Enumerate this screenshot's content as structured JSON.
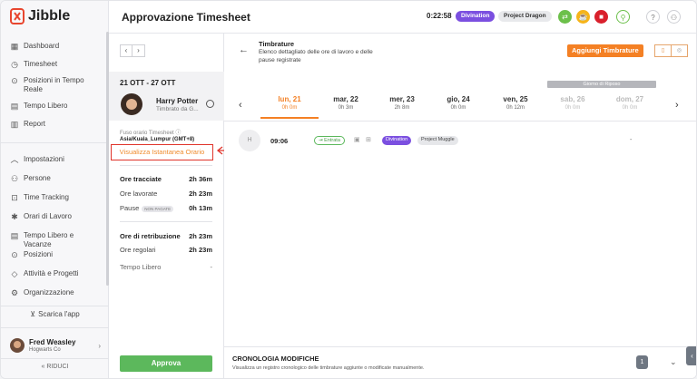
{
  "app": {
    "brand": "Jibble",
    "page_title": "Approvazione Timesheet"
  },
  "sidebar": {
    "items_top": [
      {
        "label": "Dashboard",
        "icon": "dashboard-icon"
      },
      {
        "label": "Timesheet",
        "icon": "clock-icon"
      },
      {
        "label": "Posizioni in Tempo Reale",
        "icon": "location-icon"
      },
      {
        "label": "Tempo Libero",
        "icon": "calendar-icon"
      },
      {
        "label": "Report",
        "icon": "report-icon"
      }
    ],
    "items_bottom": [
      {
        "label": "Impostazioni",
        "icon": "chevron-up-icon"
      },
      {
        "label": "Persone",
        "icon": "people-icon"
      },
      {
        "label": "Time Tracking",
        "icon": "time-tracking-icon"
      },
      {
        "label": "Orari di Lavoro",
        "icon": "work-schedule-icon"
      },
      {
        "label": "Tempo Libero e Vacanze",
        "icon": "calendar-icon"
      },
      {
        "label": "Posizioni",
        "icon": "location-icon"
      },
      {
        "label": "Attività e Progetti",
        "icon": "tag-icon"
      },
      {
        "label": "Organizzazione",
        "icon": "gear-icon"
      }
    ],
    "download": "Scarica l'app",
    "user": {
      "name": "Fred Weasley",
      "org": "Hogwarts Co"
    },
    "collapse": "RIDUCI"
  },
  "topbar": {
    "timer": "0:22:58",
    "activity": "Divination",
    "project": "Project Dragon"
  },
  "panel": {
    "week": "21 OTT - 27 OTT",
    "person": {
      "name": "Harry Potter",
      "status": "Timbrato da G..."
    },
    "tz_label": "Fuso orario Timesheet",
    "tz_value": "Asia/Kuala_Lumpur (GMT+8)",
    "snapshot_link": "Visualizza Istantanea Orario",
    "tracked": {
      "label": "Ore tracciate",
      "value": "2h 36m"
    },
    "worked": {
      "label": "Ore lavorate",
      "value": "2h 23m"
    },
    "breaks": {
      "label": "Pause",
      "badge": "NON PAGATE",
      "value": "0h 13m"
    },
    "pay": {
      "label": "Ore di retribuzione",
      "value": "2h 23m"
    },
    "regular": {
      "label": "Ore regolari",
      "value": "2h 23m"
    },
    "free": {
      "label": "Tempo Libero",
      "value": "-"
    },
    "approve": "Approva"
  },
  "main": {
    "section_title": "Timbrature",
    "section_desc": "Elenco dettagliato delle ore di lavoro e delle pause registrate",
    "add_button": "Aggiungi Timbrature",
    "rest_day": "Giorno di Riposo",
    "days": [
      {
        "name": "lun, 21",
        "hours": "0h 0m"
      },
      {
        "name": "mar, 22",
        "hours": "0h 3m"
      },
      {
        "name": "mer, 23",
        "hours": "2h 8m"
      },
      {
        "name": "gio, 24",
        "hours": "0h 0m"
      },
      {
        "name": "ven, 25",
        "hours": "0h 12m"
      },
      {
        "name": "sab, 26",
        "hours": "0h 0m"
      },
      {
        "name": "dom, 27",
        "hours": "0h 0m"
      }
    ],
    "entry": {
      "avatar": "H",
      "time": "09:06",
      "type": "Entrata",
      "activity": "Divination",
      "project": "Project Muggle",
      "dash": "-"
    },
    "history": {
      "title": "CRONOLOGIA MODIFICHE",
      "desc": "Visualizza un registro cronologico delle timbrature aggiunte o modificate manualmente.",
      "count": "1"
    }
  },
  "colors": {
    "accent": "#f48024",
    "approve": "#5cb85c",
    "activity": "#7b4fe0",
    "highlight": "#e0342b"
  }
}
